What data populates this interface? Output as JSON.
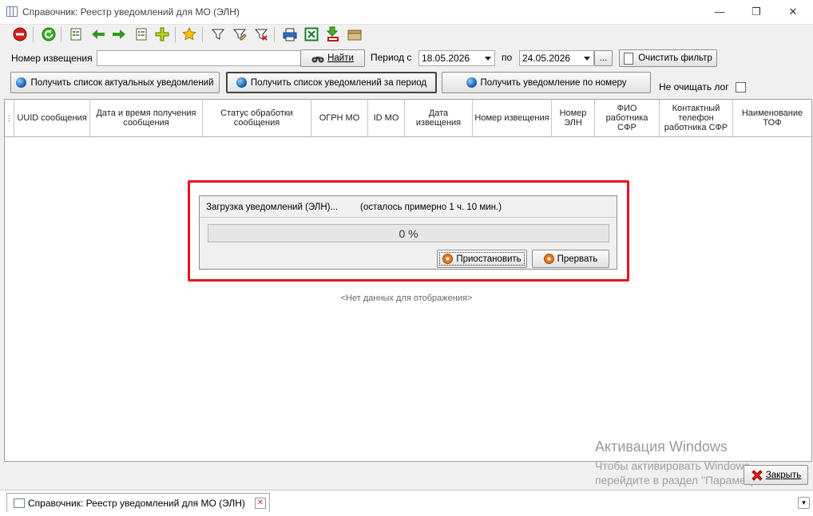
{
  "window": {
    "title": "Справочник: Реестр уведомлений для МО (ЭЛН)",
    "minimize": "—",
    "restore": "❐",
    "close": "✕"
  },
  "toolbar": {
    "icons": [
      "stop-icon",
      "refresh-icon",
      "columns-icon",
      "arrow-left-icon",
      "arrow-right-icon",
      "list-icon",
      "add-icon",
      "favorite-icon",
      "filter-icon",
      "filter-edit-icon",
      "filter-clear-icon",
      "print-icon",
      "excel-icon",
      "export-xml-icon",
      "archive-icon"
    ]
  },
  "search": {
    "number_label": "Номер извещения",
    "number_value": "",
    "find_button": "Найти",
    "period_label": "Период с",
    "date_from": "18.05.2026",
    "to_label": "по",
    "date_to": "24.05.2026",
    "dots_button": "...",
    "clear_filter_button": "Очистить фильтр"
  },
  "actions": {
    "get_current": "Получить список актуальных уведомлений",
    "get_period": "Получить список уведомлений за период",
    "get_by_number": "Получить уведомление по номеру",
    "no_clear_log_label": "Не очищать лог",
    "no_clear_log_checked": false
  },
  "grid": {
    "columns": [
      "UUID сообщения",
      "Дата и время получения сообщения",
      "Статус обработки сообщения",
      "ОГРН МО",
      "ID МО",
      "Дата извещения",
      "Номер извещения",
      "Номер ЭЛН",
      "ФИО работника СФР",
      "Контактный телефон работника СФР",
      "Наименование ТОФ"
    ],
    "empty_text": "<Нет данных для отображения>"
  },
  "progress": {
    "title": "Загрузка уведомлений (ЭЛН)...",
    "remaining": "(осталось примерно 1 ч. 10 мин.)",
    "percent_text": "0 %",
    "percent": 0,
    "pause_button": "Приостановить",
    "abort_button": "Прервать"
  },
  "footer": {
    "close_button": "Закрыть",
    "activation_title": "Активация Windows",
    "activation_line1": "Чтобы активировать Windows,",
    "activation_line2": "перейдите в раздел \"Параметры\"."
  },
  "tabs": {
    "active_tab": "Справочник: Реестр уведомлений для МО (ЭЛН)"
  }
}
